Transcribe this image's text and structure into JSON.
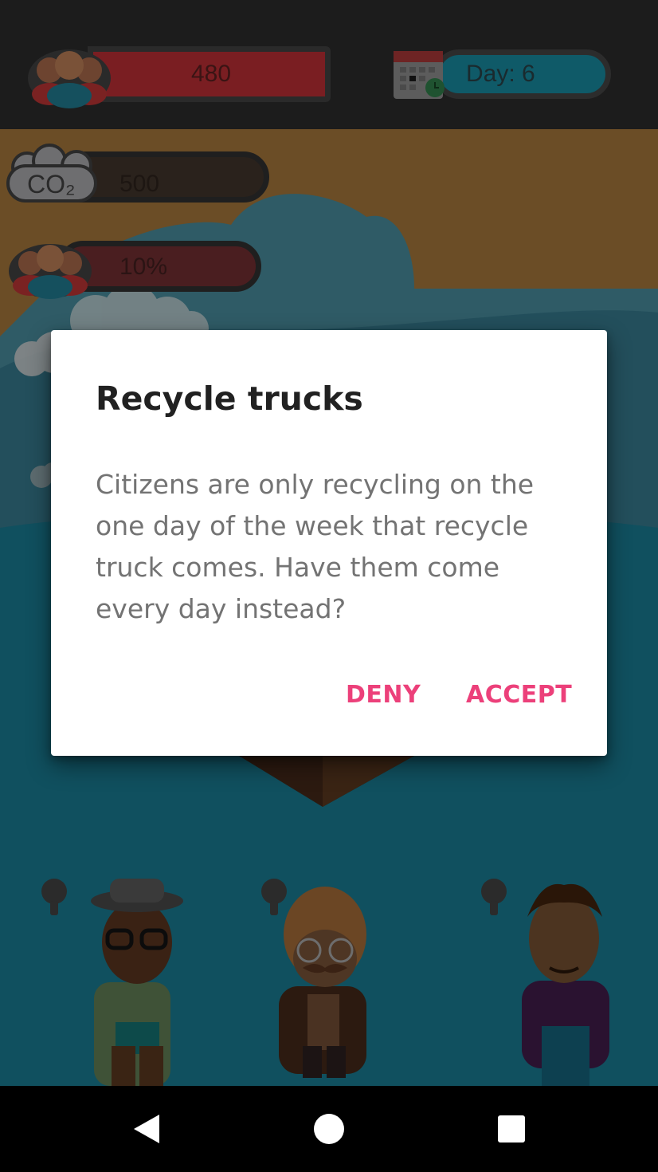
{
  "hud": {
    "population_value": "480",
    "day_label": "Day: 6",
    "co2_label": "CO₂",
    "co2_value": "500",
    "approval_value": "10%"
  },
  "dialog": {
    "title": "Recycle trucks",
    "message": "Citizens are only recycling on the one day of the week that recycle truck comes. Have them come every day instead?",
    "deny_label": "DENY",
    "accept_label": "ACCEPT"
  },
  "navbar": {
    "back_icon": "back-triangle-icon",
    "home_icon": "home-circle-icon",
    "recents_icon": "recents-square-icon"
  },
  "colors": {
    "accent": "#ec407a",
    "title": "#212121",
    "message": "#737373"
  }
}
